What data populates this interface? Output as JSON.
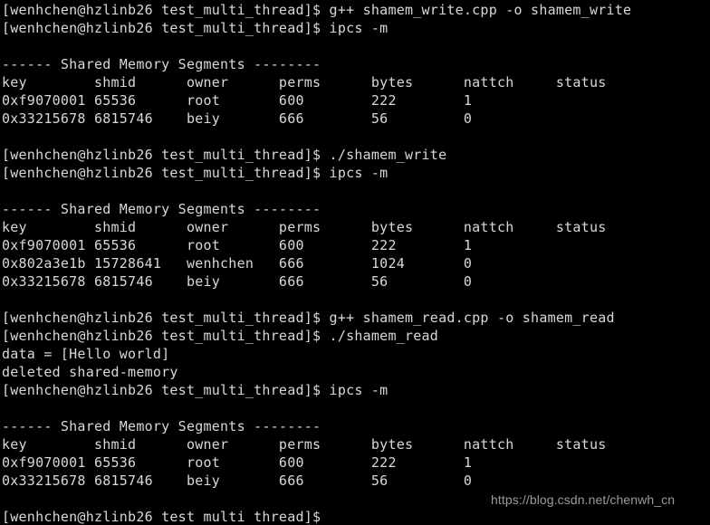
{
  "terminal": {
    "title": "shell session",
    "colors": {
      "background": "#000000",
      "foreground": "#d8d8d8",
      "watermark": "#9a9a9a"
    },
    "prompt": "[wenhchen@hzlinb26 test_multi_thread]$ ",
    "lines": [
      "[wenhchen@hzlinb26 test_multi_thread]$ g++ shamem_write.cpp -o shamem_write",
      "[wenhchen@hzlinb26 test_multi_thread]$ ipcs -m",
      "",
      "------ Shared Memory Segments --------",
      "key        shmid      owner      perms      bytes      nattch     status",
      "0xf9070001 65536      root       600        222        1",
      "0x33215678 6815746    beiy       666        56         0",
      "",
      "[wenhchen@hzlinb26 test_multi_thread]$ ./shamem_write",
      "[wenhchen@hzlinb26 test_multi_thread]$ ipcs -m",
      "",
      "------ Shared Memory Segments --------",
      "key        shmid      owner      perms      bytes      nattch     status",
      "0xf9070001 65536      root       600        222        1",
      "0x802a3e1b 15728641   wenhchen   666        1024       0",
      "0x33215678 6815746    beiy       666        56         0",
      "",
      "[wenhchen@hzlinb26 test_multi_thread]$ g++ shamem_read.cpp -o shamem_read",
      "[wenhchen@hzlinb26 test_multi_thread]$ ./shamem_read",
      "data = [Hello world]",
      "deleted shared-memory",
      "[wenhchen@hzlinb26 test_multi_thread]$ ipcs -m",
      "",
      "------ Shared Memory Segments --------",
      "key        shmid      owner      perms      bytes      nattch     status",
      "0xf9070001 65536      root       600        222        1",
      "0x33215678 6815746    beiy       666        56         0",
      "",
      "[wenhchen@hzlinb26 test multi thread]$ "
    ],
    "watermark": "https://blog.csdn.net/chenwh_cn"
  }
}
